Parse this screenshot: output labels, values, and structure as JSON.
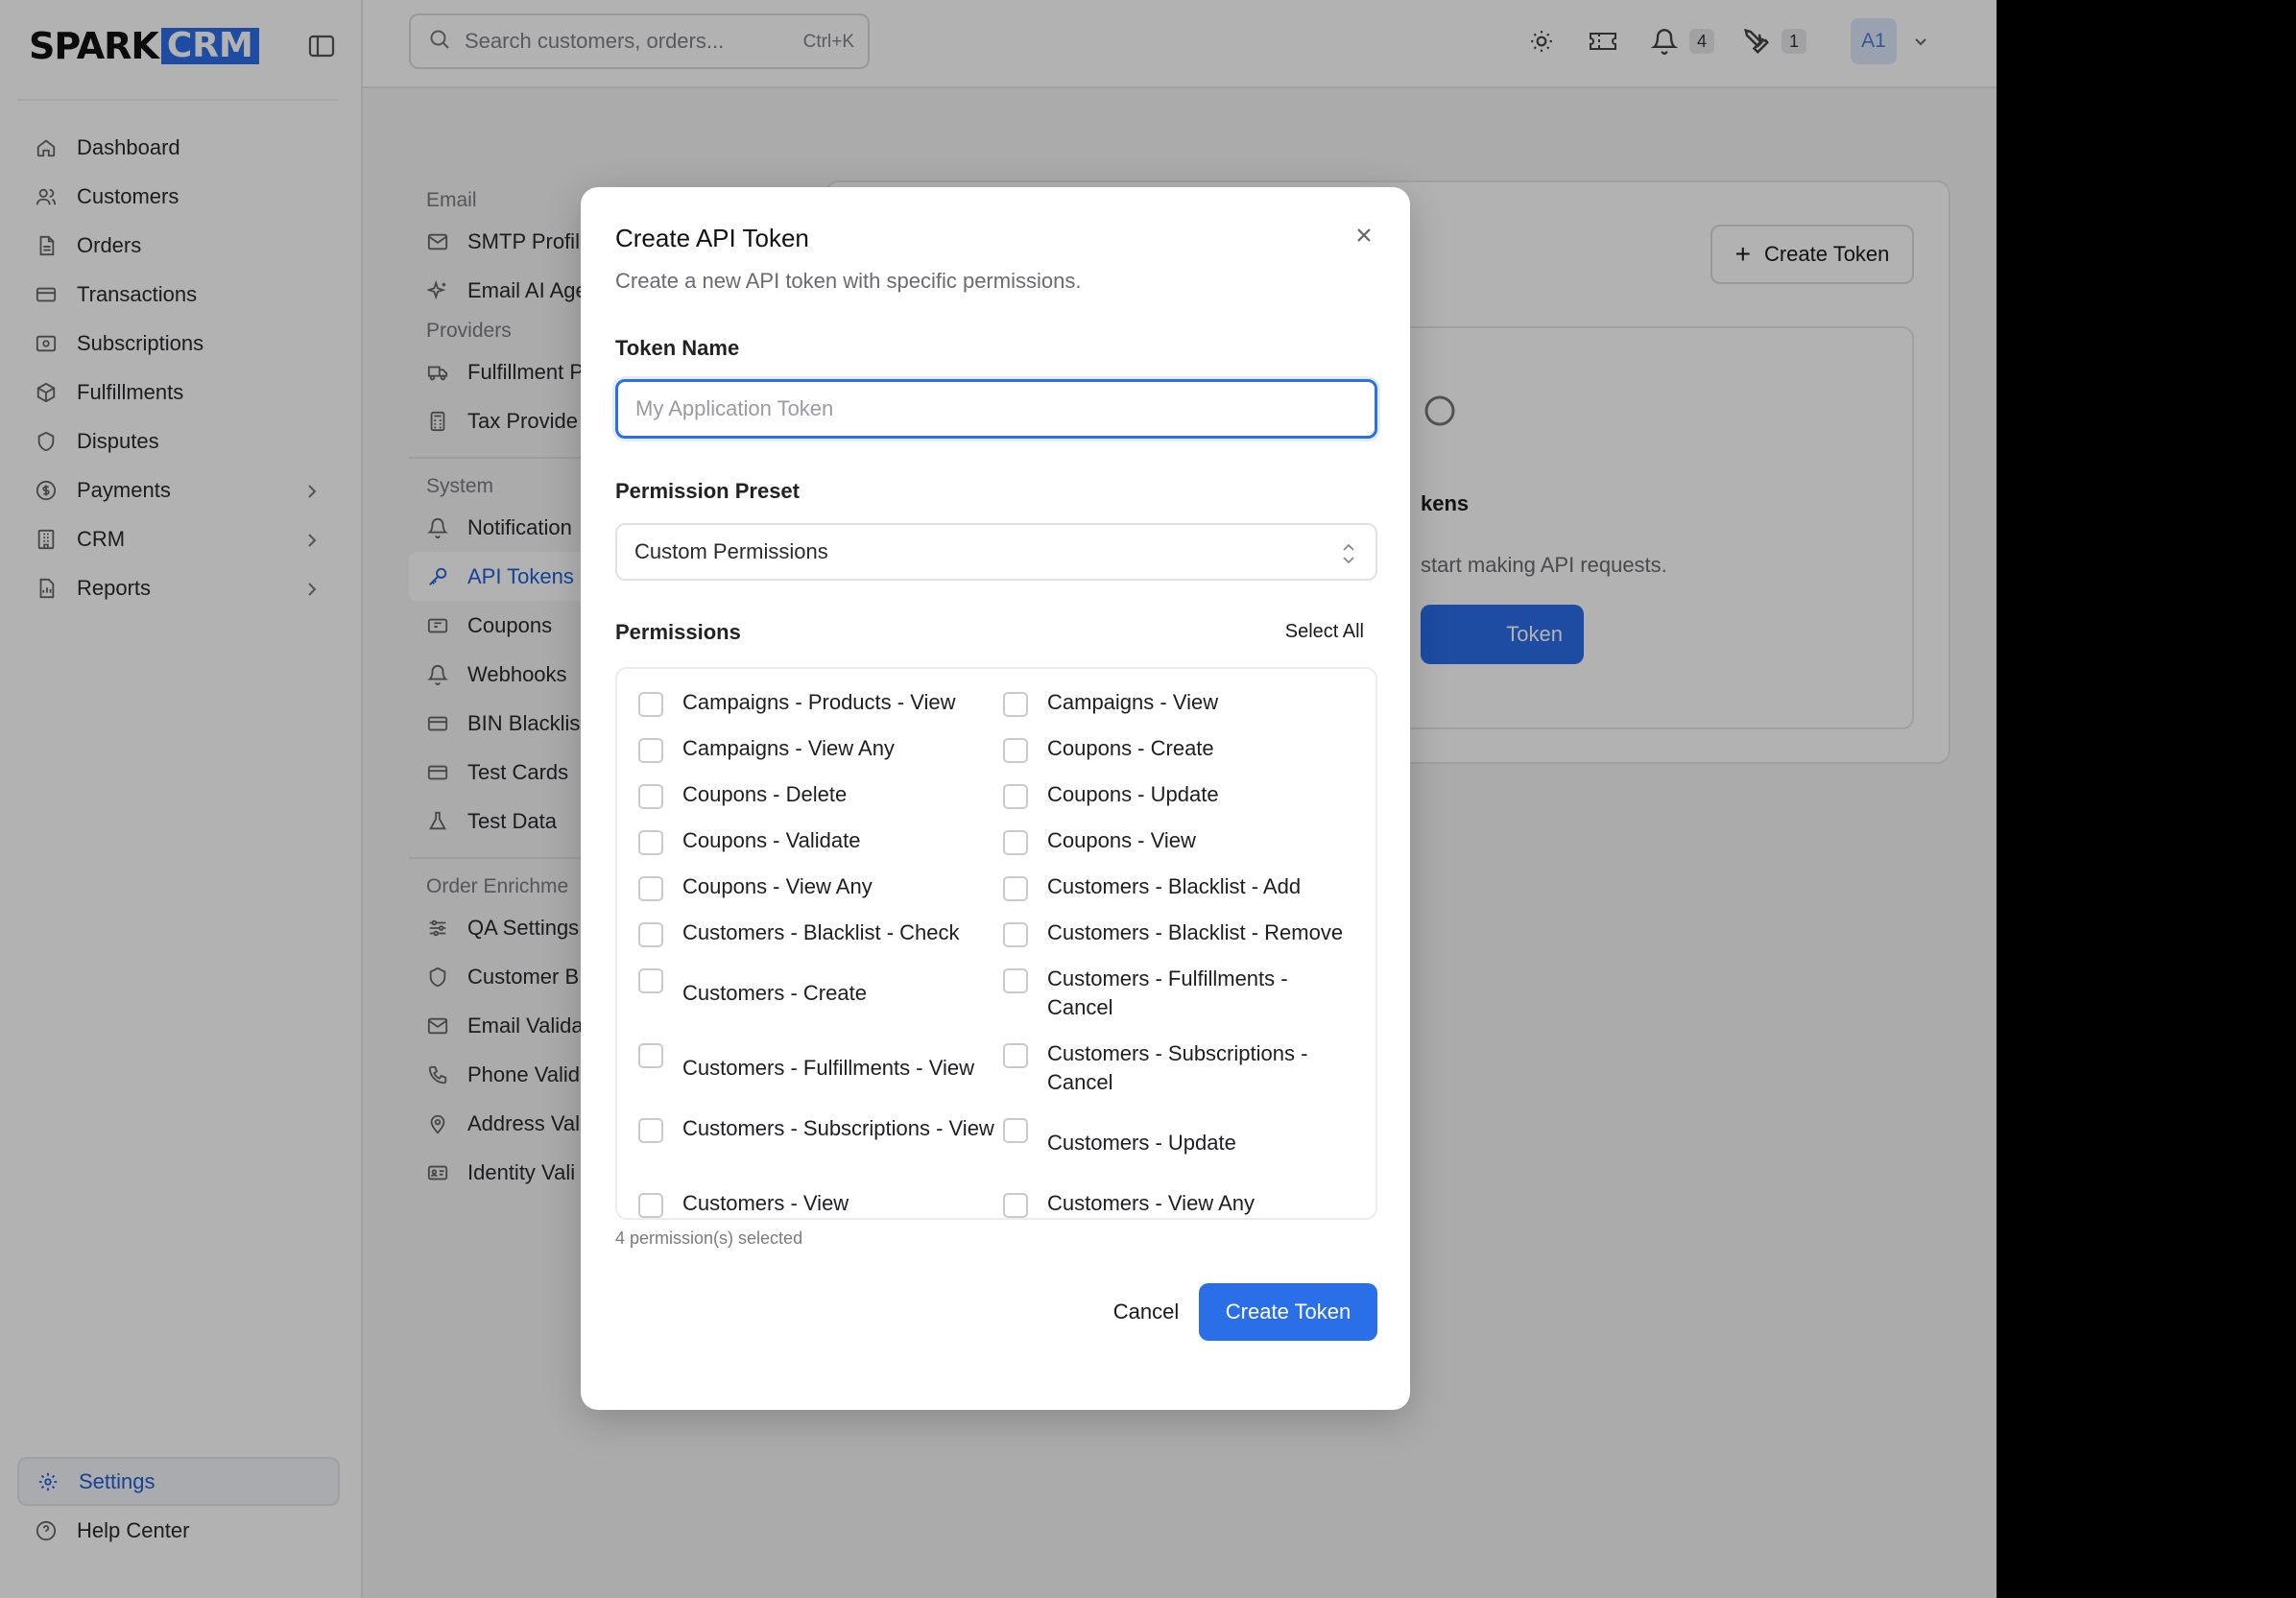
{
  "app": {
    "logo_spark": "SPARK",
    "logo_crm": "CRM",
    "brand_color": "#2a6ee8"
  },
  "sidebar": {
    "items": [
      {
        "label": "Dashboard",
        "icon": "home-icon"
      },
      {
        "label": "Customers",
        "icon": "users-icon"
      },
      {
        "label": "Orders",
        "icon": "file-icon"
      },
      {
        "label": "Transactions",
        "icon": "credit-card-icon"
      },
      {
        "label": "Subscriptions",
        "icon": "receipt-icon"
      },
      {
        "label": "Fulfillments",
        "icon": "package-icon"
      },
      {
        "label": "Disputes",
        "icon": "shield-icon"
      },
      {
        "label": "Payments",
        "icon": "dollar-icon"
      },
      {
        "label": "CRM",
        "icon": "building-icon"
      },
      {
        "label": "Reports",
        "icon": "report-icon"
      }
    ],
    "bottom": [
      {
        "label": "Settings",
        "icon": "gear-icon"
      },
      {
        "label": "Help Center",
        "icon": "help-icon"
      }
    ]
  },
  "topbar": {
    "search_placeholder": "Search customers, orders...",
    "search_shortcut": "Ctrl+K",
    "notifications_count": "4",
    "tools_count": "1",
    "avatar_initials": "A1"
  },
  "subnav": {
    "email_heading": "Email",
    "smtp": "SMTP Profil",
    "email_ai": "Email AI Age",
    "providers_heading": "Providers",
    "fulfillment": "Fulfillment P",
    "tax": "Tax Provide",
    "system_heading": "System",
    "notifications": "Notification",
    "api_tokens": "API Tokens",
    "coupons": "Coupons",
    "webhooks": "Webhooks",
    "bin": "BIN Blacklis",
    "test_cards": "Test Cards",
    "test_data": "Test Data",
    "order_heading": "Order Enrichme",
    "qa": "QA Settings",
    "customer_b": "Customer B",
    "email_valid": "Email Valida",
    "phone_valid": "Phone Valid",
    "address_valid": "Address Val",
    "identity_valid": "Identity Vali"
  },
  "card": {
    "create_label": "Create Token",
    "empty_title": "kens",
    "empty_desc": "start making API requests.",
    "empty_btn": "Token"
  },
  "modal": {
    "title": "Create API Token",
    "subtitle": "Create a new API token with specific permissions.",
    "token_name_label": "Token Name",
    "token_name_placeholder": "My Application Token",
    "token_name_value": "",
    "preset_label": "Permission Preset",
    "preset_value": "Custom Permissions",
    "permissions_label": "Permissions",
    "select_all": "Select All",
    "permissions": [
      "Campaigns - Products - View",
      "Campaigns - View",
      "Campaigns - View Any",
      "Coupons - Create",
      "Coupons - Delete",
      "Coupons - Update",
      "Coupons - Validate",
      "Coupons - View",
      "Coupons - View Any",
      "Customers - Blacklist - Add",
      "Customers - Blacklist - Check",
      "Customers - Blacklist - Remove",
      "Customers - Create",
      "Customers - Fulfillments - Cancel",
      "Customers - Fulfillments - View",
      "Customers - Subscriptions - Cancel",
      "Customers - Subscriptions - View",
      "Customers - Update",
      "Customers - View",
      "Customers - View Any"
    ],
    "selected_count": "4 permission(s) selected",
    "cancel": "Cancel",
    "create": "Create Token"
  }
}
